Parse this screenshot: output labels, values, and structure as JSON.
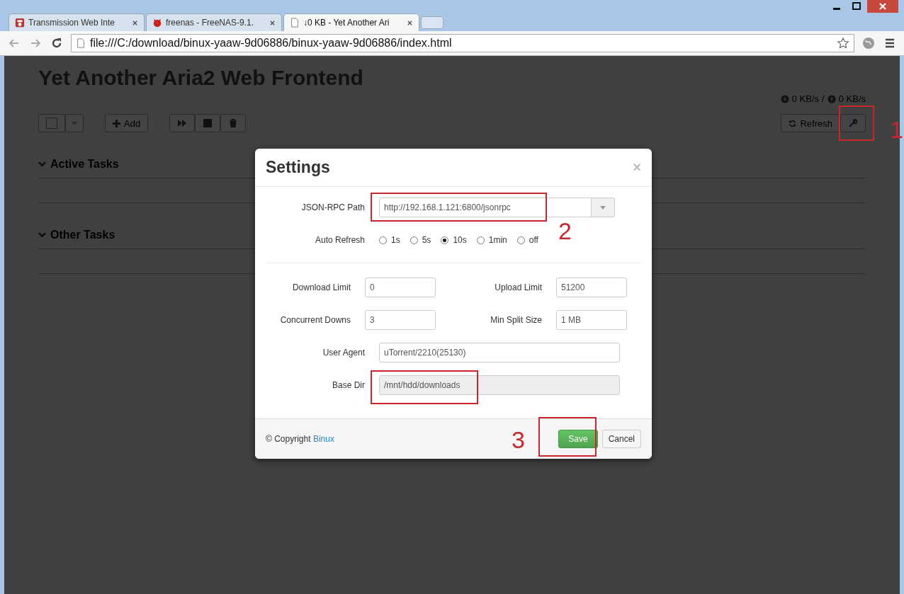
{
  "browser": {
    "tabs": [
      {
        "title": "Transmission Web Inte",
        "kind": "transmission",
        "selected": false
      },
      {
        "title": "freenas - FreeNAS-9.1.",
        "kind": "freenas",
        "selected": false
      },
      {
        "title": "↓0 KB - Yet Another Ari",
        "kind": "page",
        "selected": true
      }
    ],
    "address": "file:///C:/download/binux-yaaw-9d06886/binux-yaaw-9d06886/index.html"
  },
  "page": {
    "title": "Yet Another Aria2 Web Frontend",
    "download_speed": "0 KB/s",
    "separator": "/",
    "upload_speed": "0 KB/s",
    "select_all_checked": false,
    "add_button": "Add",
    "refresh_button": "Refresh",
    "sections": [
      "Active Tasks",
      "Other Tasks"
    ]
  },
  "settings": {
    "title": "Settings",
    "close": "×",
    "rpc_path": {
      "label": "JSON-RPC Path",
      "value": "http://192.168.1.121:6800/jsonrpc"
    },
    "auto_refresh": {
      "label": "Auto Refresh",
      "options": [
        {
          "label": "1s",
          "selected": false
        },
        {
          "label": "5s",
          "selected": false
        },
        {
          "label": "10s",
          "selected": true
        },
        {
          "label": "1min",
          "selected": false
        },
        {
          "label": "off",
          "selected": false
        }
      ]
    },
    "pair_rows": [
      [
        {
          "label": "Download Limit",
          "value": "0"
        },
        {
          "label": "Upload Limit",
          "value": "51200"
        }
      ],
      [
        {
          "label": "Concurrent Downs",
          "value": "3"
        },
        {
          "label": "Min Split Size",
          "value": "1 MB"
        }
      ]
    ],
    "wide_fields": [
      {
        "label": "User Agent",
        "value": "uTorrent/2210(25130)",
        "disabled": false
      },
      {
        "label": "Base Dir",
        "value": "/mnt/hdd/downloads",
        "disabled": true
      }
    ],
    "copyright": "© Copyright",
    "author_link": "Binux",
    "save_button": "Save",
    "cancel_button": "Cancel"
  },
  "annotations": [
    {
      "kind": "numbered",
      "number": "1"
    },
    {
      "kind": "numbered",
      "number": "2"
    },
    {
      "kind": "box"
    },
    {
      "kind": "numbered",
      "number": "3"
    }
  ]
}
